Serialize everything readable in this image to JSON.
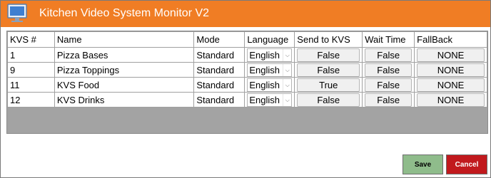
{
  "window": {
    "title": "Kitchen Video System Monitor V2"
  },
  "icons": {
    "app": "monitor-icon",
    "dropdown": "chevron-down-icon"
  },
  "colors": {
    "titlebar": "#f07d24",
    "save": "#8fbc8b",
    "cancel": "#c1191d",
    "grid_background": "#a3a3a3"
  },
  "grid": {
    "columns": [
      "KVS #",
      "Name",
      "Mode",
      "Language",
      "Send to KVS",
      "Wait Time",
      "FallBack"
    ],
    "rows": [
      {
        "kvs": "1",
        "name": "Pizza Bases",
        "mode": "Standard",
        "language": "English",
        "send": "False",
        "wait": "False",
        "fallback": "NONE"
      },
      {
        "kvs": "9",
        "name": "Pizza Toppings",
        "mode": "Standard",
        "language": "English",
        "send": "False",
        "wait": "False",
        "fallback": "NONE"
      },
      {
        "kvs": "11",
        "name": "KVS Food",
        "mode": "Standard",
        "language": "English",
        "send": "True",
        "wait": "False",
        "fallback": "NONE"
      },
      {
        "kvs": "12",
        "name": "KVS Drinks",
        "mode": "Standard",
        "language": "English",
        "send": "False",
        "wait": "False",
        "fallback": "NONE"
      }
    ]
  },
  "footer": {
    "save_label": "Save",
    "cancel_label": "Cancel"
  }
}
